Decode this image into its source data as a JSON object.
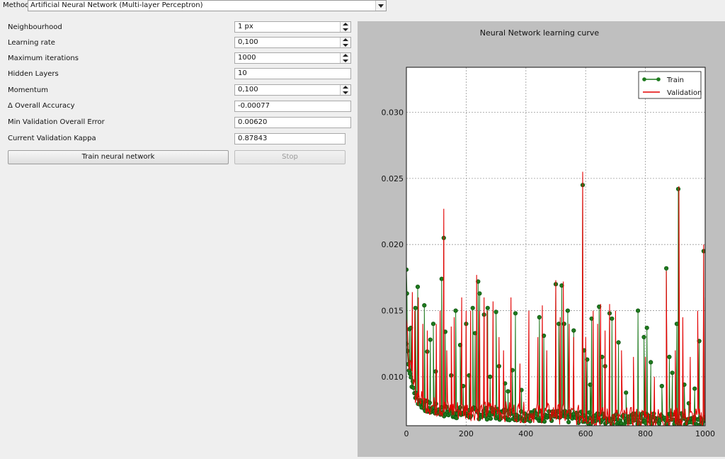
{
  "method": {
    "label": "Method",
    "selected": "Artificial Neural Network (Multi-layer Perceptron)"
  },
  "params": {
    "neighbourhood": {
      "label": "Neighbourhood",
      "value": "1 px"
    },
    "learning_rate": {
      "label": "Learning rate",
      "value": "0,100"
    },
    "max_iterations": {
      "label": "Maximum iterations",
      "value": "1000"
    },
    "hidden_layers": {
      "label": "Hidden Layers",
      "value": "10"
    },
    "momentum": {
      "label": "Momentum",
      "value": "0,100"
    },
    "overall_accuracy": {
      "label": "Δ Overall Accuracy",
      "value": "-0.00077"
    },
    "min_val_error": {
      "label": "Min Validation Overall Error",
      "value": "0.00620"
    },
    "val_kappa": {
      "label": "Current Validation Kappa",
      "value": "0.87843"
    }
  },
  "buttons": {
    "train": "Train neural network",
    "stop": "Stop"
  },
  "colors": {
    "train": "#1e7a1e",
    "validation": "#e30000",
    "panel_bg": "#bfbfbf"
  },
  "chart_data": {
    "type": "line",
    "title": "Neural Network learning curve",
    "xlabel": "",
    "ylabel": "",
    "xlim": [
      0,
      1000
    ],
    "ylim": [
      0.0063,
      0.0334
    ],
    "xticks": [
      "0",
      "200",
      "400",
      "600",
      "800",
      "1000"
    ],
    "yticks": [
      "0.010",
      "0.015",
      "0.020",
      "0.025",
      "0.030"
    ],
    "grid": true,
    "legend_position": "top-right",
    "series": [
      {
        "name": "Train",
        "style": "line-markers",
        "baseline": [
          [
            0,
            0.0125
          ],
          [
            10,
            0.0105
          ],
          [
            20,
            0.0094
          ],
          [
            30,
            0.0086
          ],
          [
            50,
            0.008
          ],
          [
            80,
            0.0076
          ],
          [
            150,
            0.0073
          ],
          [
            300,
            0.0072
          ],
          [
            500,
            0.007
          ],
          [
            700,
            0.0068
          ],
          [
            900,
            0.0068
          ],
          [
            1000,
            0.0068
          ]
        ],
        "spikes": [
          [
            0,
            0.0181
          ],
          [
            2,
            0.0163
          ],
          [
            10,
            0.0136
          ],
          [
            15,
            0.0137
          ],
          [
            30,
            0.0152
          ],
          [
            38,
            0.0168
          ],
          [
            60,
            0.0154
          ],
          [
            70,
            0.0119
          ],
          [
            80,
            0.0128
          ],
          [
            90,
            0.014
          ],
          [
            98,
            0.0104
          ],
          [
            118,
            0.0174
          ],
          [
            125,
            0.0205
          ],
          [
            130,
            0.0134
          ],
          [
            150,
            0.0101
          ],
          [
            165,
            0.015
          ],
          [
            180,
            0.0124
          ],
          [
            190,
            0.0093
          ],
          [
            200,
            0.014
          ],
          [
            210,
            0.0101
          ],
          [
            222,
            0.0152
          ],
          [
            230,
            0.0133
          ],
          [
            240,
            0.0172
          ],
          [
            245,
            0.0163
          ],
          [
            260,
            0.0147
          ],
          [
            272,
            0.0152
          ],
          [
            280,
            0.01
          ],
          [
            300,
            0.0149
          ],
          [
            310,
            0.0108
          ],
          [
            330,
            0.0095
          ],
          [
            340,
            0.0089
          ],
          [
            355,
            0.0105
          ],
          [
            365,
            0.0148
          ],
          [
            385,
            0.009
          ],
          [
            445,
            0.0145
          ],
          [
            460,
            0.0131
          ],
          [
            500,
            0.017
          ],
          [
            510,
            0.014
          ],
          [
            520,
            0.0169
          ],
          [
            528,
            0.014
          ],
          [
            540,
            0.015
          ],
          [
            560,
            0.0135
          ],
          [
            590,
            0.0245
          ],
          [
            595,
            0.012
          ],
          [
            605,
            0.0113
          ],
          [
            615,
            0.0094
          ],
          [
            620,
            0.0144
          ],
          [
            645,
            0.0153
          ],
          [
            655,
            0.0115
          ],
          [
            665,
            0.0108
          ],
          [
            680,
            0.0148
          ],
          [
            688,
            0.0144
          ],
          [
            710,
            0.0126
          ],
          [
            735,
            0.0088
          ],
          [
            775,
            0.015
          ],
          [
            795,
            0.013
          ],
          [
            805,
            0.0137
          ],
          [
            818,
            0.0111
          ],
          [
            855,
            0.0093
          ],
          [
            870,
            0.0182
          ],
          [
            880,
            0.0115
          ],
          [
            890,
            0.0103
          ],
          [
            905,
            0.014
          ],
          [
            910,
            0.0242
          ],
          [
            930,
            0.0094
          ],
          [
            945,
            0.008
          ],
          [
            965,
            0.0091
          ],
          [
            980,
            0.0127
          ],
          [
            995,
            0.0195
          ]
        ]
      },
      {
        "name": "Validation",
        "style": "line",
        "baseline": [
          [
            0,
            0.014
          ],
          [
            10,
            0.011
          ],
          [
            20,
            0.0096
          ],
          [
            30,
            0.0088
          ],
          [
            50,
            0.0082
          ],
          [
            80,
            0.0078
          ],
          [
            150,
            0.0075
          ],
          [
            300,
            0.0074
          ],
          [
            500,
            0.0072
          ],
          [
            700,
            0.0069
          ],
          [
            900,
            0.0069
          ],
          [
            1000,
            0.0069
          ]
        ],
        "spikes": [
          [
            0,
            0.0144
          ],
          [
            20,
            0.0164
          ],
          [
            28,
            0.015
          ],
          [
            40,
            0.016
          ],
          [
            55,
            0.014
          ],
          [
            70,
            0.0135
          ],
          [
            100,
            0.014
          ],
          [
            113,
            0.015
          ],
          [
            125,
            0.0227
          ],
          [
            135,
            0.012
          ],
          [
            150,
            0.0138
          ],
          [
            160,
            0.0145
          ],
          [
            185,
            0.016
          ],
          [
            200,
            0.015
          ],
          [
            215,
            0.015
          ],
          [
            235,
            0.0177
          ],
          [
            245,
            0.015
          ],
          [
            260,
            0.016
          ],
          [
            270,
            0.015
          ],
          [
            290,
            0.0157
          ],
          [
            310,
            0.013
          ],
          [
            325,
            0.012
          ],
          [
            350,
            0.016
          ],
          [
            380,
            0.011
          ],
          [
            410,
            0.015
          ],
          [
            440,
            0.013
          ],
          [
            455,
            0.0154
          ],
          [
            470,
            0.012
          ],
          [
            500,
            0.0173
          ],
          [
            515,
            0.0145
          ],
          [
            525,
            0.0172
          ],
          [
            545,
            0.014
          ],
          [
            560,
            0.013
          ],
          [
            590,
            0.0255
          ],
          [
            600,
            0.013
          ],
          [
            625,
            0.015
          ],
          [
            640,
            0.014
          ],
          [
            650,
            0.0155
          ],
          [
            665,
            0.0135
          ],
          [
            680,
            0.0155
          ],
          [
            700,
            0.015
          ],
          [
            720,
            0.012
          ],
          [
            760,
            0.0115
          ],
          [
            800,
            0.0115
          ],
          [
            830,
            0.01
          ],
          [
            870,
            0.018
          ],
          [
            900,
            0.012
          ],
          [
            912,
            0.0244
          ],
          [
            925,
            0.0145
          ],
          [
            950,
            0.0115
          ],
          [
            975,
            0.015
          ],
          [
            995,
            0.02
          ],
          [
            1000,
            0.016
          ]
        ]
      }
    ]
  }
}
